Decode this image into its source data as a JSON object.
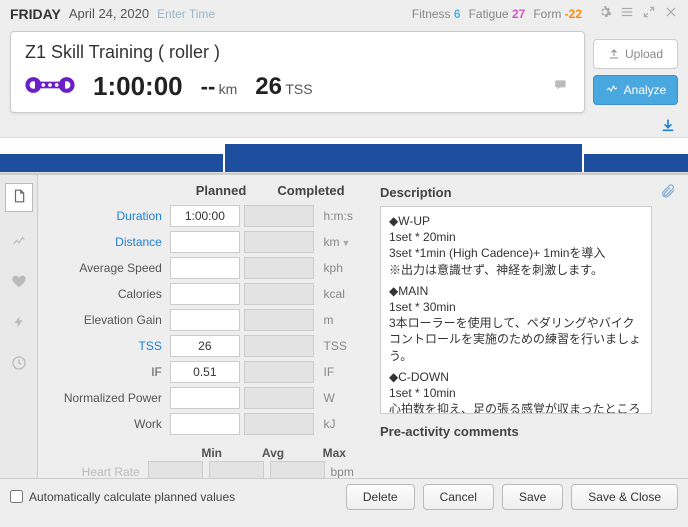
{
  "header": {
    "day": "FRIDAY",
    "date": "April 24, 2020",
    "enter_time": "Enter Time",
    "fitness_label": "Fitness",
    "fitness_value": "6",
    "fatigue_label": "Fatigue",
    "fatigue_value": "27",
    "form_label": "Form",
    "form_value": "-22"
  },
  "workout": {
    "title": "Z1 Skill Training ( roller )",
    "duration": "1:00:00",
    "distance": "--",
    "distance_unit": "km",
    "tss": "26",
    "tss_unit": "TSS"
  },
  "buttons": {
    "upload": "Upload",
    "analyze": "Analyze"
  },
  "planned": {
    "head_planned": "Planned",
    "head_completed": "Completed",
    "rows": {
      "duration": {
        "label": "Duration",
        "value": "1:00:00",
        "unit": "h:m:s"
      },
      "distance": {
        "label": "Distance",
        "value": "",
        "unit": "km"
      },
      "avg_speed": {
        "label": "Average Speed",
        "value": "",
        "unit": "kph"
      },
      "calories": {
        "label": "Calories",
        "value": "",
        "unit": "kcal"
      },
      "elev_gain": {
        "label": "Elevation Gain",
        "value": "",
        "unit": "m"
      },
      "tss": {
        "label": "TSS",
        "value": "26",
        "unit": "TSS"
      },
      "if": {
        "label": "IF",
        "value": "0.51",
        "unit": "IF"
      },
      "np": {
        "label": "Normalized Power",
        "value": "",
        "unit": "W"
      },
      "work": {
        "label": "Work",
        "value": "",
        "unit": "kJ"
      },
      "hr": {
        "label": "Heart Rate",
        "unit": "bpm"
      }
    },
    "min": "Min",
    "avg": "Avg",
    "max": "Max"
  },
  "description": {
    "title": "Description",
    "wup_h": "◆W-UP",
    "wup_l1": "1set * 20min",
    "wup_l2": "3set *1min (High Cadence)+ 1minを導入",
    "wup_l3": "※出力は意識せず、神経を刺激します。",
    "main_h": "◆MAIN",
    "main_l1": "1set * 30min",
    "main_l2": "3本ローラーを使用して、ペダリングやバイクコントロールを実施のための練習を行いましょう。",
    "cdown_h": "◆C-DOWN",
    "cdown_l1": "1set * 10min",
    "cdown_l2": "心拍数を抑え、足の張る感覚が収まったところでバイクからおり、セルフケアをしましょう。",
    "preact": "Pre-activity comments"
  },
  "footer": {
    "auto_calc": "Automatically calculate planned values",
    "delete": "Delete",
    "cancel": "Cancel",
    "save": "Save",
    "save_close": "Save & Close"
  }
}
